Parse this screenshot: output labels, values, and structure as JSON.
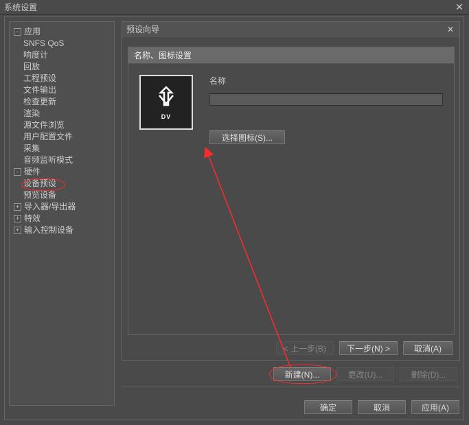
{
  "window": {
    "title": "系统设置"
  },
  "tree": {
    "app": {
      "label": "应用",
      "toggle": "-",
      "items": [
        "SNFS QoS",
        "响度计",
        "回放",
        "工程预设",
        "文件输出",
        "检查更新",
        "渲染",
        "源文件浏览",
        "用户配置文件",
        "采集",
        "音频监听模式"
      ]
    },
    "hw": {
      "label": "硬件",
      "toggle": "-",
      "items": [
        "设备预设",
        "预览设备"
      ]
    },
    "io": {
      "label": "导入器/导出器",
      "toggle": "+"
    },
    "fx": {
      "label": "特效",
      "toggle": "+"
    },
    "input": {
      "label": "输入控制设备",
      "toggle": "+"
    }
  },
  "wizard": {
    "title": "预设向导",
    "section": "名称、图标设置",
    "name_label": "名称",
    "name_value": "",
    "choose_icon": "选择图标(S)...",
    "icon_caption": "DV",
    "prev": "< 上一步(B)",
    "next": "下一步(N) >",
    "cancel": "取消(A)"
  },
  "actions": {
    "new": "新建(N)...",
    "change": "更改(U)...",
    "delete": "删除(D)..."
  },
  "dialog": {
    "ok": "确定",
    "cancel": "取消",
    "apply": "应用(A)"
  }
}
